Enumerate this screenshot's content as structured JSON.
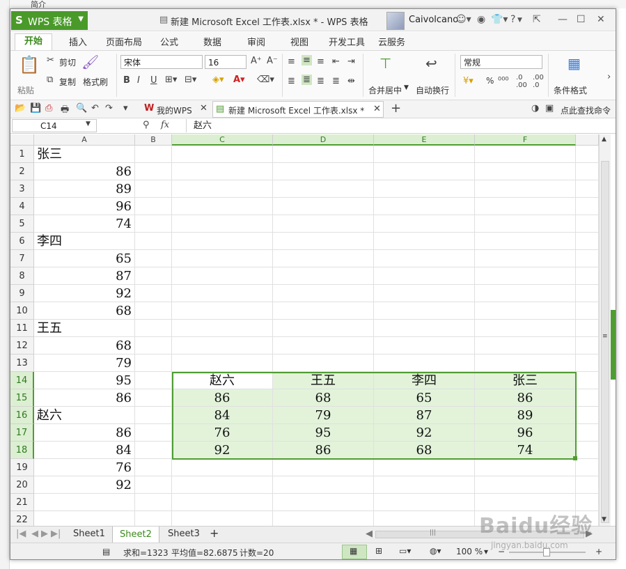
{
  "background": {
    "top_label": "简介"
  },
  "titlebar": {
    "app_label": "WPS 表格",
    "window_title": "新建 Microsoft Excel 工作表.xlsx * - WPS 表格",
    "username": "Caivolcano",
    "help": "?"
  },
  "menu_tabs": [
    "开始",
    "插入",
    "页面布局",
    "公式",
    "数据",
    "审阅",
    "视图",
    "开发工具",
    "云服务"
  ],
  "ribbon": {
    "paste": "粘贴",
    "cut": "剪切",
    "copy": "复制",
    "format_painter": "格式刷",
    "font_name": "宋体",
    "font_size": "16",
    "merge_center": "合并居中",
    "wrap_text": "自动换行",
    "number_format": "常规",
    "percent": "%",
    "conditional_format": "条件格式"
  },
  "quickbar": {
    "wps_tab": "我的WPS",
    "doc_tab": "新建 Microsoft Excel 工作表.xlsx *",
    "search": "点此查找命令"
  },
  "formula_bar": {
    "name_box": "C14",
    "fx": "fx",
    "value": "赵六"
  },
  "columns": [
    "A",
    "B",
    "C",
    "D",
    "E",
    "F"
  ],
  "rows": [
    "1",
    "2",
    "3",
    "4",
    "5",
    "6",
    "7",
    "8",
    "9",
    "10",
    "11",
    "12",
    "13",
    "14",
    "15",
    "16",
    "17",
    "18",
    "19",
    "20",
    "21",
    "22"
  ],
  "col_a": [
    "张三",
    "86",
    "89",
    "96",
    "74",
    "李四",
    "65",
    "87",
    "92",
    "68",
    "王五",
    "68",
    "79",
    "95",
    "86",
    "赵六",
    "86",
    "84",
    "76",
    "92",
    "",
    ""
  ],
  "table": {
    "headers": [
      "赵六",
      "王五",
      "李四",
      "张三"
    ],
    "rows": [
      [
        "86",
        "68",
        "65",
        "86"
      ],
      [
        "84",
        "79",
        "87",
        "89"
      ],
      [
        "76",
        "95",
        "92",
        "96"
      ],
      [
        "92",
        "86",
        "68",
        "74"
      ]
    ]
  },
  "sheets": [
    "Sheet1",
    "Sheet2",
    "Sheet3"
  ],
  "active_sheet": "Sheet2",
  "status": {
    "sum": "求和=1323",
    "average": "平均值=82.6875",
    "count": "计数=20",
    "zoom": "100 %"
  },
  "watermark": {
    "text": "Baidu经验",
    "url": "jingyan.baidu.com"
  },
  "colors": {
    "accent": "#4f9d32",
    "selection_fill": "#e2f3da",
    "app_button": "#4a9a2a"
  }
}
